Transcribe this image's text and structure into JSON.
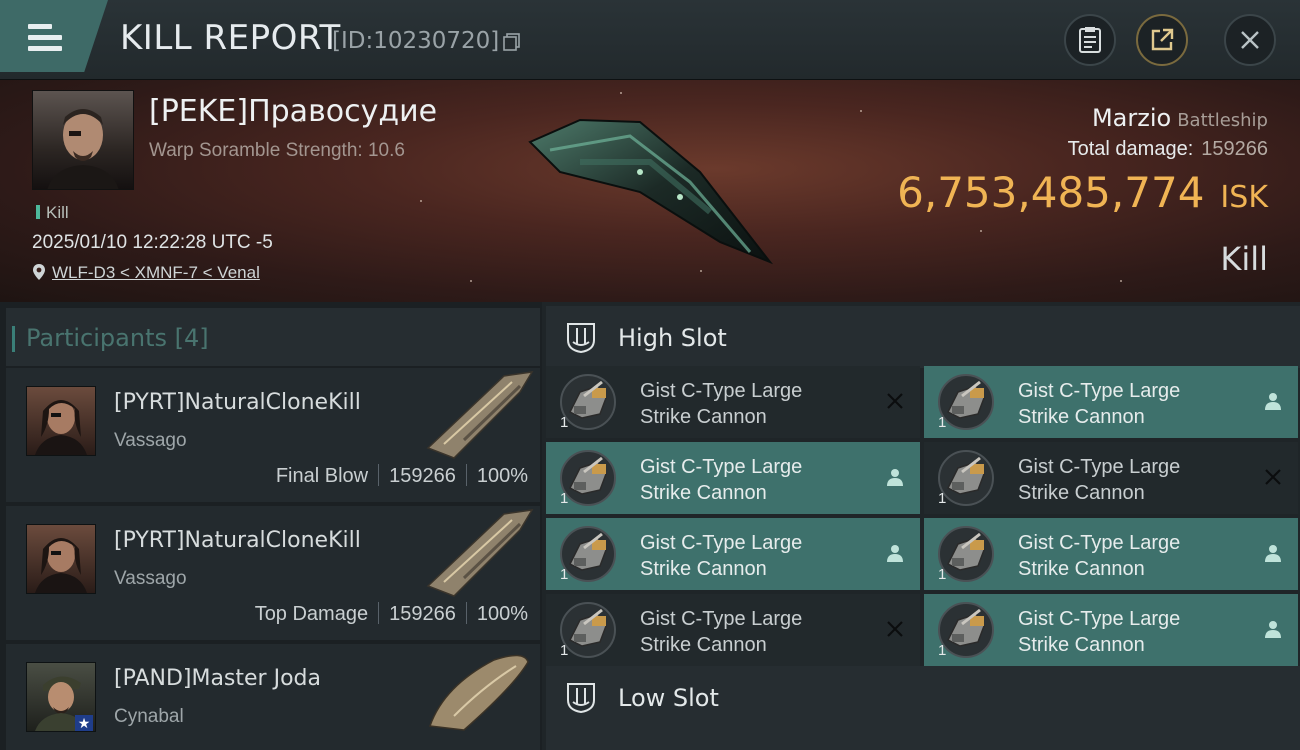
{
  "header": {
    "title": "KILL REPORT",
    "report_id": "[ID:10230720]"
  },
  "victim": {
    "name": "[PEKE]Правосудие",
    "scramble": "Warp Soramble Strength: 10.6",
    "tag": "Kill",
    "datetime": "2025/01/10 12:22:28 UTC -5",
    "location": "WLF-D3 < XMNF-7 < Venal"
  },
  "ship": {
    "name": "Marzio",
    "class": "Battleship",
    "total_damage_label": "Total damage:",
    "total_damage": "159266",
    "isk_value": "6,753,485,774",
    "isk_unit": "ISK",
    "result": "Kill"
  },
  "participants": {
    "label": "Participants",
    "count": "[4]",
    "items": [
      {
        "name": "[PYRT]NaturalCloneKill",
        "ship": "Vassago",
        "role": "Final Blow",
        "damage": "159266",
        "percent": "100%"
      },
      {
        "name": "[PYRT]NaturalCloneKill",
        "ship": "Vassago",
        "role": "Top Damage",
        "damage": "159266",
        "percent": "100%"
      },
      {
        "name": "[PAND]Master Joda",
        "ship": "Cynabal"
      }
    ]
  },
  "slots": {
    "high": {
      "label": "High Slot",
      "modules": [
        {
          "line1": "Gist C-Type Large",
          "line2": "Strike Cannon",
          "qty": "1",
          "status": "destroyed"
        },
        {
          "line1": "Gist C-Type Large",
          "line2": "Strike Cannon",
          "qty": "1",
          "status": "dropped"
        },
        {
          "line1": "Gist C-Type Large",
          "line2": "Strike Cannon",
          "qty": "1",
          "status": "dropped"
        },
        {
          "line1": "Gist C-Type Large",
          "line2": "Strike Cannon",
          "qty": "1",
          "status": "destroyed"
        },
        {
          "line1": "Gist C-Type Large",
          "line2": "Strike Cannon",
          "qty": "1",
          "status": "dropped"
        },
        {
          "line1": "Gist C-Type Large",
          "line2": "Strike Cannon",
          "qty": "1",
          "status": "dropped"
        },
        {
          "line1": "Gist C-Type Large",
          "line2": "Strike Cannon",
          "qty": "1",
          "status": "destroyed"
        },
        {
          "line1": "Gist C-Type Large",
          "line2": "Strike Cannon",
          "qty": "1",
          "status": "dropped"
        }
      ]
    },
    "low": {
      "label": "Low Slot"
    }
  },
  "colors": {
    "accent": "#3e716c",
    "isk": "#f0b454",
    "banner": "#4a2620"
  }
}
